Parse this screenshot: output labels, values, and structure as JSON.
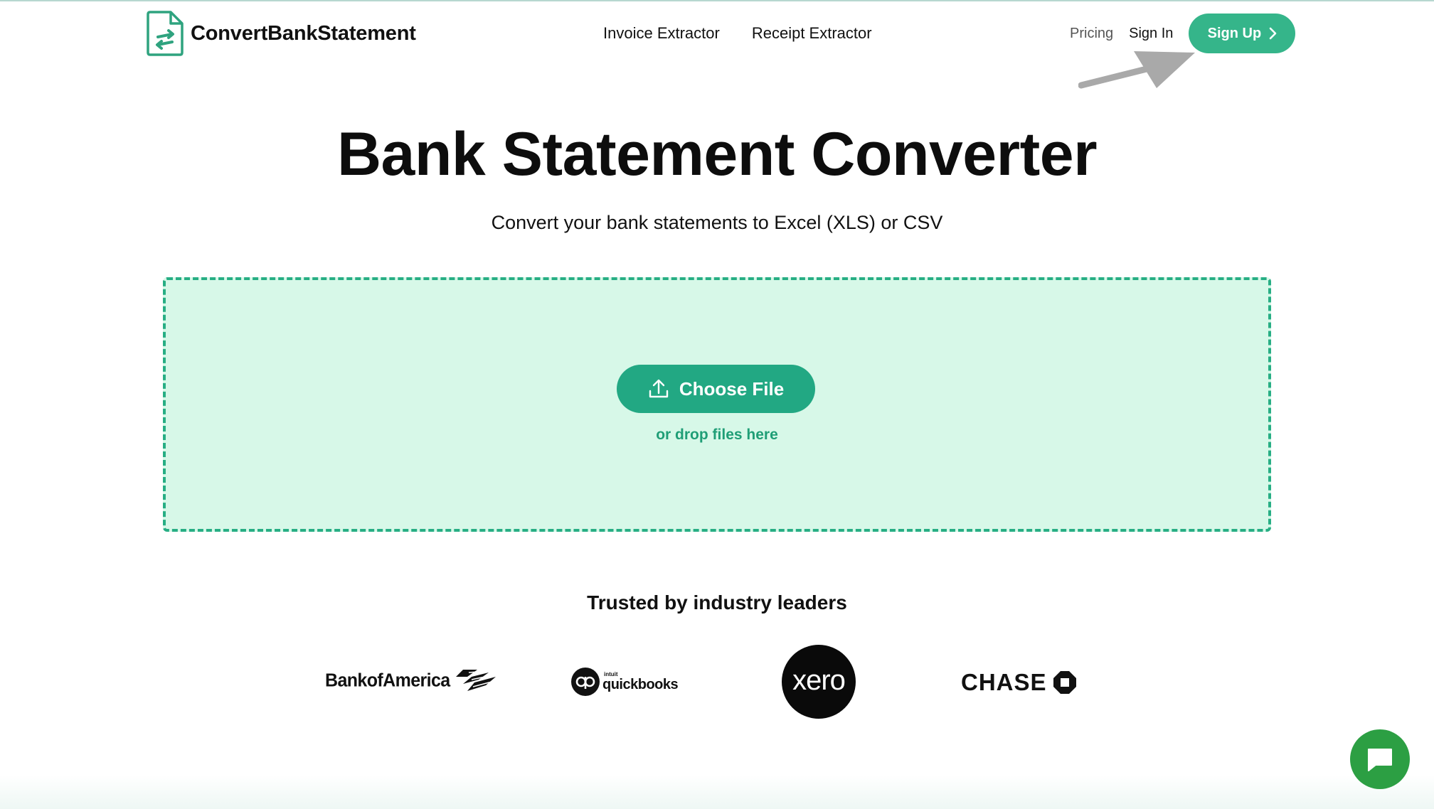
{
  "header": {
    "brand": "ConvertBankStatement",
    "nav": [
      {
        "label": "Invoice Extractor"
      },
      {
        "label": "Receipt Extractor"
      }
    ],
    "pricing": "Pricing",
    "sign_in": "Sign In",
    "sign_up": "Sign Up"
  },
  "hero": {
    "title": "Bank Statement Converter",
    "subtitle": "Convert your bank statements to Excel (XLS) or CSV"
  },
  "dropzone": {
    "button_label": "Choose File",
    "hint": "or drop files here"
  },
  "trusted": {
    "heading": "Trusted by industry leaders",
    "logos": [
      {
        "name": "Bank of America",
        "text": "BankofAmerica",
        "icon": "boa-flag-icon"
      },
      {
        "name": "QuickBooks",
        "intuit": "intuit",
        "text": "quickbooks",
        "icon": "qb-circle-icon"
      },
      {
        "name": "Xero",
        "text": "xero"
      },
      {
        "name": "Chase",
        "text": "CHASE",
        "icon": "chase-octagon-icon"
      }
    ]
  },
  "colors": {
    "accent": "#35b58a",
    "dropzone_bg": "#d7f8e8",
    "dropzone_border": "#27ae84",
    "chat": "#2c9f43"
  }
}
